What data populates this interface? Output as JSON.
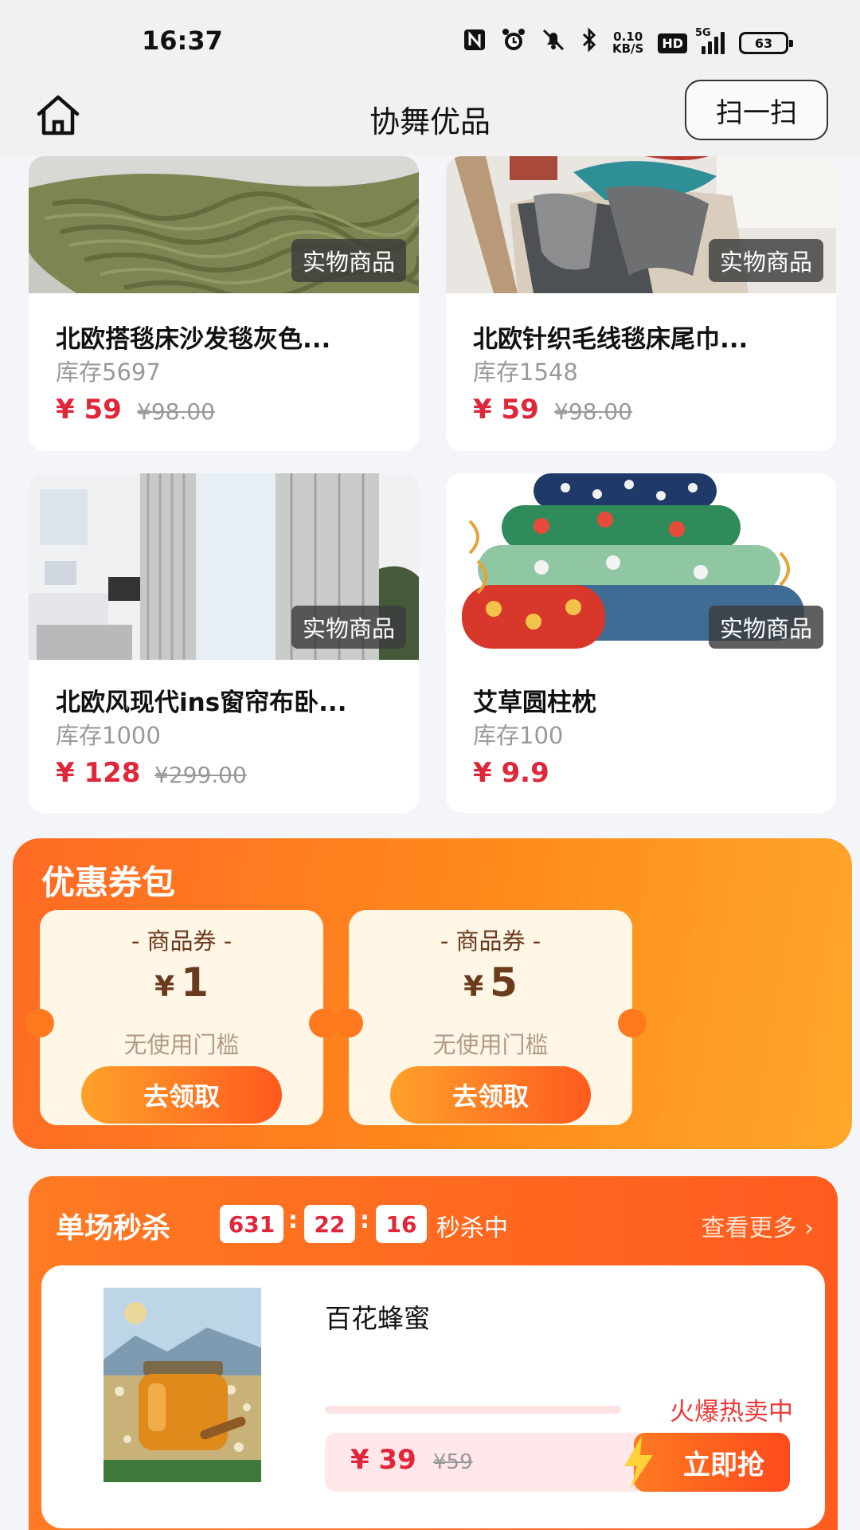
{
  "status_bar": {
    "time": "16:37",
    "net_speed_value": "0.10",
    "net_speed_unit": "KB/S",
    "hd": "HD",
    "network": "5G",
    "battery": "63",
    "icons": [
      "nfc-icon",
      "alarm-icon",
      "mute-icon",
      "bluetooth-icon",
      "signal-icon",
      "battery-icon"
    ]
  },
  "header": {
    "title": "协舞优品",
    "scan_label": "扫一扫",
    "home_icon": "home-icon"
  },
  "products": [
    {
      "name": "北欧搭毯床沙发毯灰色...",
      "stock": "库存5697",
      "price": "¥ 59",
      "original_price": "¥98.00",
      "tag": "实物商品"
    },
    {
      "name": "北欧针织毛线毯床尾巾...",
      "stock": "库存1548",
      "price": "¥ 59",
      "original_price": "¥98.00",
      "tag": "实物商品"
    },
    {
      "name": "北欧风现代ins窗帘布卧...",
      "stock": "库存1000",
      "price": "¥ 128",
      "original_price": "¥299.00",
      "tag": "实物商品"
    },
    {
      "name": "艾草圆柱枕",
      "stock": "库存100",
      "price": "¥ 9.9",
      "original_price": "",
      "tag": "实物商品"
    }
  ],
  "coupons": {
    "title": "优惠券包",
    "items": [
      {
        "type": "- 商品券 -",
        "currency": "¥",
        "amount": "1",
        "condition": "无使用门槛",
        "button": "去领取"
      },
      {
        "type": "- 商品券 -",
        "currency": "¥",
        "amount": "5",
        "condition": "无使用门槛",
        "button": "去领取"
      }
    ]
  },
  "flash_sale": {
    "title": "单场秒杀",
    "countdown": [
      "631",
      "22",
      "16"
    ],
    "separator": ":",
    "status": "秒杀中",
    "more": "查看更多 ›",
    "item": {
      "name": "百花蜂蜜",
      "hot_label": "火爆热卖中",
      "price": "¥ 39",
      "original_price": "¥59",
      "buy_label": "立即抢"
    }
  },
  "colors": {
    "accent_red": "#e0263a",
    "coupon_orange": "#ff7a1f",
    "flash_orange": "#ff5b1f"
  }
}
